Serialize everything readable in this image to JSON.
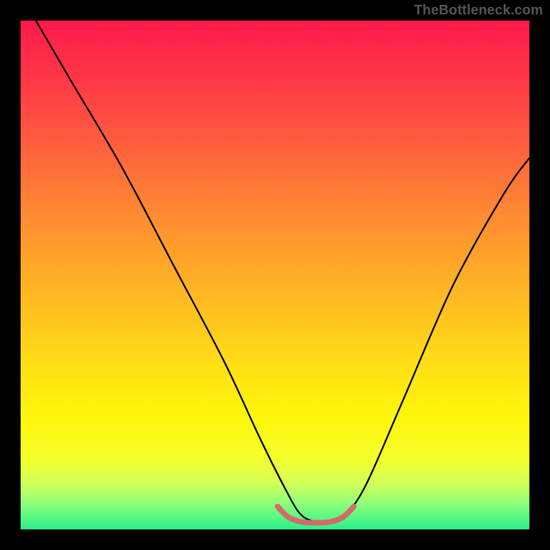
{
  "watermark": "TheBottleneck.com",
  "chart_data": {
    "type": "line",
    "title": "",
    "xlabel": "",
    "ylabel": "",
    "xlim": [
      0,
      100
    ],
    "ylim": [
      0,
      100
    ],
    "series": [
      {
        "name": "curve",
        "x": [
          3,
          10,
          20,
          30,
          40,
          47,
          52,
          55,
          58,
          61,
          64,
          68,
          75,
          85,
          95,
          100
        ],
        "y": [
          100,
          88,
          71,
          52,
          33,
          18,
          8,
          3,
          1.5,
          1.5,
          3,
          9,
          25,
          48,
          66,
          73
        ]
      }
    ],
    "accent_segment": {
      "x": [
        50.5,
        52.5,
        55,
        58,
        61,
        63.5,
        65.5
      ],
      "y": [
        4.5,
        2.5,
        1.5,
        1.3,
        1.5,
        2.5,
        4.5
      ]
    },
    "gradient_stops": [
      {
        "pos": 0.0,
        "color": "#ff1a4b"
      },
      {
        "pos": 0.5,
        "color": "#ffb020"
      },
      {
        "pos": 0.8,
        "color": "#fffb10"
      },
      {
        "pos": 1.0,
        "color": "#2cf08b"
      }
    ]
  }
}
